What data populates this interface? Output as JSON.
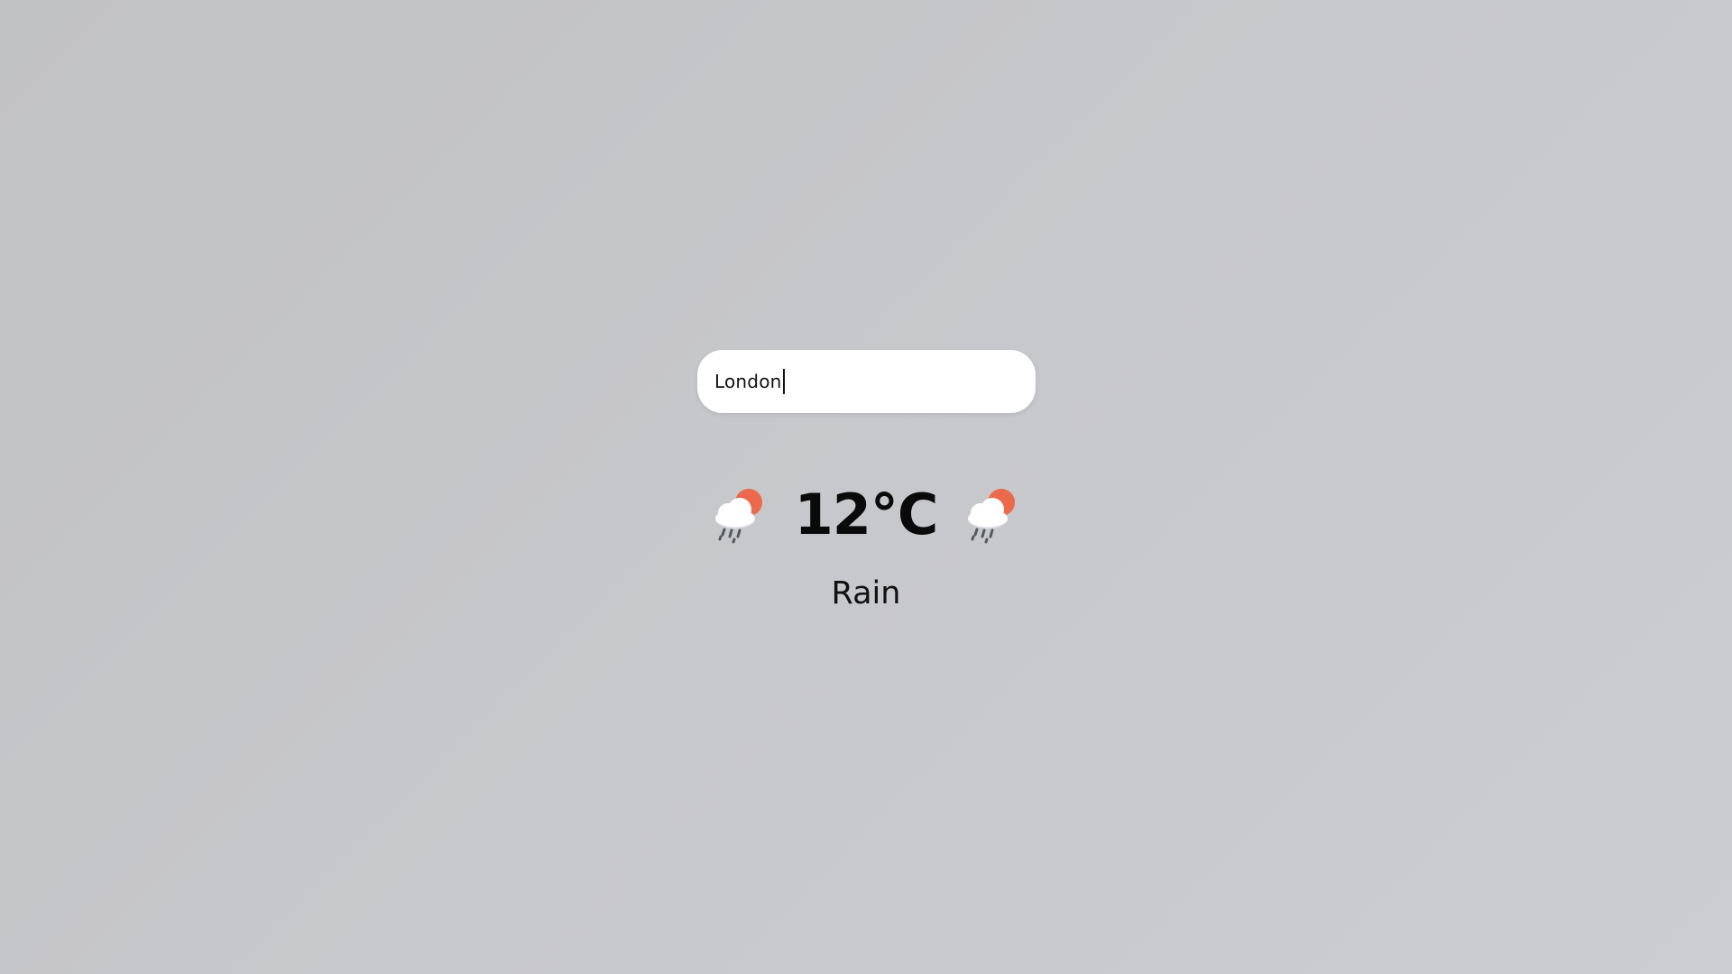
{
  "search": {
    "value": "London"
  },
  "weather": {
    "temperature": "12°C",
    "condition": "Rain",
    "icon": "sun-cloud-rain-icon"
  },
  "colors": {
    "background": "#c7c8cb",
    "sun": "#ec6a4c",
    "cloud": "#ffffff",
    "rain": "#555a60"
  }
}
